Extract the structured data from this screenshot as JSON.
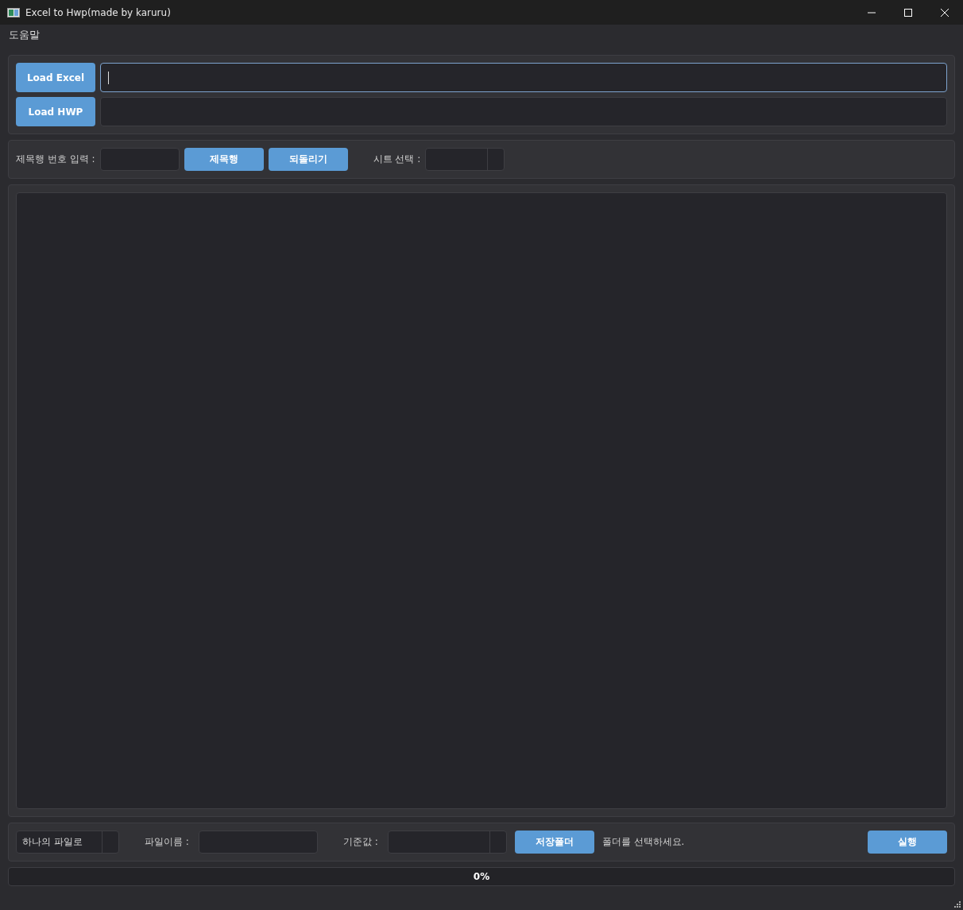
{
  "window": {
    "title": "Excel to Hwp(made by karuru)"
  },
  "menu": [
    "도움말"
  ],
  "loaders": [
    {
      "button": "Load Excel",
      "focused": true
    },
    {
      "button": "Load HWP",
      "focused": false
    }
  ],
  "header_row": {
    "label": "제목행 번호 입력 :",
    "set_button": "제목행",
    "undo_button": "되돌리기",
    "sheet_label": "시트 선택 :"
  },
  "output": {
    "mode": "하나의 파일로",
    "filename_label": "파일이름 :",
    "criteria_label": "기준값 :",
    "folder_button": "저장폴더",
    "folder_status": "폴더를 선택하세요.",
    "run_button": "실행"
  },
  "progress": {
    "level": 0,
    "reading": "0%"
  }
}
